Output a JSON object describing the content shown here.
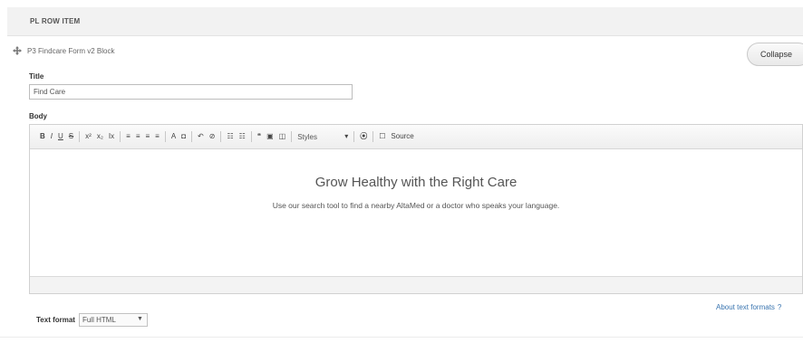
{
  "section_header": "PL ROW ITEM",
  "block": {
    "label": "P3 Findcare Form v2 Block"
  },
  "collapse_label": "Collapse",
  "title_field": {
    "label": "Title",
    "value": "Find Care"
  },
  "body_field": {
    "label": "Body"
  },
  "toolbar": {
    "styles_label": "Styles",
    "source_label": "Source",
    "buttons": [
      "B",
      "I",
      "U",
      "S",
      "x²",
      "x₂",
      "Ix",
      "≡",
      "≡",
      "≡",
      "≡",
      "A",
      "◘",
      "↶",
      "⊘",
      "☷",
      "☷",
      "❝",
      "▣",
      "◫",
      "⦿",
      "☐"
    ]
  },
  "editor_content": {
    "heading": "Grow Healthy with the Right Care",
    "paragraph": "Use our search tool to find a nearby AltaMed or a doctor who speaks your language."
  },
  "text_format": {
    "label": "Text format",
    "value": "Full HTML"
  },
  "about_link": "About text formats"
}
